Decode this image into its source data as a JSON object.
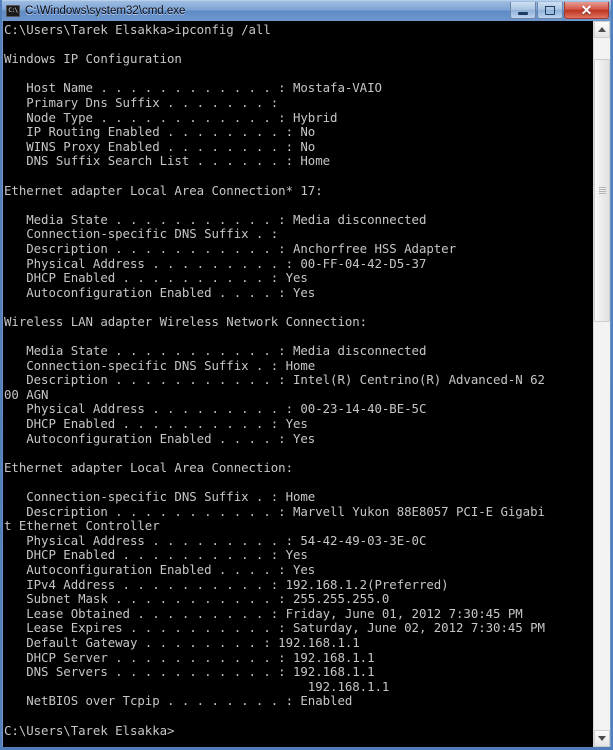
{
  "window": {
    "title": "C:\\Windows\\system32\\cmd.exe",
    "icon": "cmd-icon",
    "icon_text": "C:\\",
    "buttons": {
      "minimize_label": "",
      "maximize_label": "",
      "close_label": "✕"
    }
  },
  "console": {
    "prompt": "C:\\Users\\Tarek Elsakka>",
    "command": "ipconfig /all",
    "final_prompt": "C:\\Users\\Tarek Elsakka>",
    "sections": [
      {
        "heading": "Windows IP Configuration",
        "rows": [
          {
            "label": "Host Name",
            "dots": ". . . . . . . . . . . . :",
            "value": "Mostafa-VAIO"
          },
          {
            "label": "Primary Dns Suffix",
            "dots": ". . . . . . . :",
            "value": ""
          },
          {
            "label": "Node Type",
            "dots": ". . . . . . . . . . . . :",
            "value": "Hybrid"
          },
          {
            "label": "IP Routing Enabled",
            "dots": ". . . . . . . . :",
            "value": "No"
          },
          {
            "label": "WINS Proxy Enabled",
            "dots": ". . . . . . . . :",
            "value": "No"
          },
          {
            "label": "DNS Suffix Search List",
            "dots": ". . . . . . :",
            "value": "Home"
          }
        ]
      },
      {
        "heading": "Ethernet adapter Local Area Connection* 17:",
        "rows": [
          {
            "label": "Media State",
            "dots": ". . . . . . . . . . . :",
            "value": "Media disconnected"
          },
          {
            "label": "Connection-specific DNS Suffix",
            "dots": ". :",
            "value": ""
          },
          {
            "label": "Description",
            "dots": ". . . . . . . . . . . :",
            "value": "Anchorfree HSS Adapter"
          },
          {
            "label": "Physical Address",
            "dots": ". . . . . . . . . :",
            "value": "00-FF-04-42-D5-37"
          },
          {
            "label": "DHCP Enabled",
            "dots": ". . . . . . . . . . :",
            "value": "Yes"
          },
          {
            "label": "Autoconfiguration Enabled",
            "dots": ". . . . :",
            "value": "Yes"
          }
        ]
      },
      {
        "heading": "Wireless LAN adapter Wireless Network Connection:",
        "rows": [
          {
            "label": "Media State",
            "dots": ". . . . . . . . . . . :",
            "value": "Media disconnected"
          },
          {
            "label": "Connection-specific DNS Suffix",
            "dots": ". :",
            "value": "Home"
          },
          {
            "label": "Description",
            "dots": ". . . . . . . . . . . :",
            "value": "Intel(R) Centrino(R) Advanced-N 6200 AGN"
          },
          {
            "label": "Physical Address",
            "dots": ". . . . . . . . . :",
            "value": "00-23-14-40-BE-5C"
          },
          {
            "label": "DHCP Enabled",
            "dots": ". . . . . . . . . . :",
            "value": "Yes"
          },
          {
            "label": "Autoconfiguration Enabled",
            "dots": ". . . . :",
            "value": "Yes"
          }
        ]
      },
      {
        "heading": "Ethernet adapter Local Area Connection:",
        "rows": [
          {
            "label": "Connection-specific DNS Suffix",
            "dots": ". :",
            "value": "Home"
          },
          {
            "label": "Description",
            "dots": ". . . . . . . . . . . :",
            "value": "Marvell Yukon 88E8057 PCI-E Gigabit Ethernet Controller"
          },
          {
            "label": "Physical Address",
            "dots": ". . . . . . . . . :",
            "value": "54-42-49-03-3E-0C"
          },
          {
            "label": "DHCP Enabled",
            "dots": ". . . . . . . . . . :",
            "value": "Yes"
          },
          {
            "label": "Autoconfiguration Enabled",
            "dots": ". . . . :",
            "value": "Yes"
          },
          {
            "label": "IPv4 Address",
            "dots": ". . . . . . . . . . :",
            "value": "192.168.1.2(Preferred)"
          },
          {
            "label": "Subnet Mask",
            "dots": ". . . . . . . . . . . :",
            "value": "255.255.255.0"
          },
          {
            "label": "Lease Obtained",
            "dots": ". . . . . . . . . :",
            "value": "Friday, June 01, 2012 7:30:45 PM"
          },
          {
            "label": "Lease Expires",
            "dots": ". . . . . . . . . . :",
            "value": "Saturday, June 02, 2012 7:30:45 PM"
          },
          {
            "label": "Default Gateway",
            "dots": ". . . . . . . . :",
            "value": "192.168.1.1"
          },
          {
            "label": "DHCP Server",
            "dots": ". . . . . . . . . . . :",
            "value": "192.168.1.1"
          },
          {
            "label": "DNS Servers",
            "dots": ". . . . . . . . . . . :",
            "value": "192.168.1.1"
          },
          {
            "label": "",
            "dots": "",
            "value": "192.168.1.1"
          },
          {
            "label": "NetBIOS over Tcpip",
            "dots": ". . . . . . . . :",
            "value": "Enabled"
          }
        ]
      }
    ]
  },
  "scrollbar": {
    "up_arrow": "scroll-up-arrow",
    "down_arrow": "scroll-down-arrow",
    "thumb_top_pct": 3,
    "thumb_height_pct": 38
  }
}
